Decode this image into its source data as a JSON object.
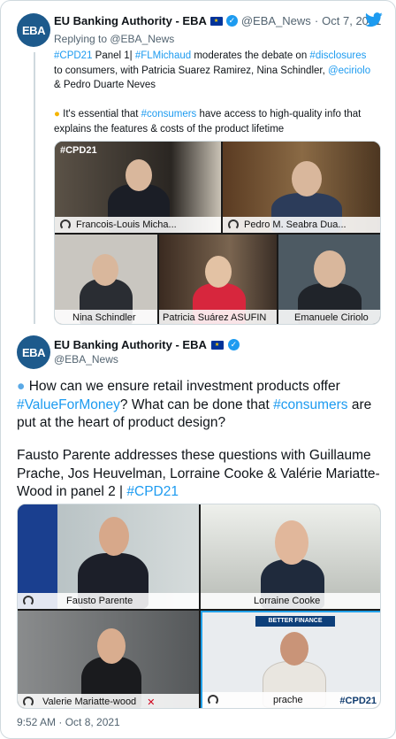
{
  "tweet1": {
    "avatar_text": "EBA",
    "name": "EU Banking Authority - EBA",
    "handle": "@EBA_News",
    "separator": "·",
    "date": "Oct 7, 2021",
    "replying_to": "Replying to @EBA_News",
    "line1_parts": [
      "#CPD21",
      " Panel 1| ",
      "#FLMichaud",
      " moderates the debate on ",
      "#disclosures"
    ],
    "line2_parts": [
      "to consumers, with Patricia Suarez Ramirez, Nina Schindler, ",
      "@eciriolo"
    ],
    "line3": "& Pedro Duarte Neves",
    "line5_parts": [
      "It's essential that ",
      "#consumers",
      " have access to high-quality info that"
    ],
    "line6": "explains the features & costs of the product lifetime",
    "video_badge": "#CPD21",
    "participants": [
      "Francois-Louis Micha...",
      "Pedro M. Seabra Dua...",
      "Nina Schindler",
      "Patricia Suárez ASUFIN",
      "Emanuele Ciriolo"
    ]
  },
  "tweet2": {
    "avatar_text": "EBA",
    "name": "EU Banking Authority - EBA",
    "handle": "@EBA_News",
    "p1_parts": [
      "How can we ensure retail investment products offer ",
      "#ValueForMoney",
      "? What can be done that ",
      "#consumers",
      " are put at the heart of product design?"
    ],
    "p2_parts": [
      "Fausto Parente addresses these questions with Guillaume Prache, Jos Heuvelman, Lorraine Cooke & Valérie Mariatte-Wood in panel 2 | ",
      "#CPD21"
    ],
    "participants": [
      "Fausto Parente",
      "Lorraine Cooke",
      "Valerie Mariatte-wood",
      "prache"
    ],
    "video_badge": "#CPD21",
    "banner_text": "BETTER FINANCE",
    "timestamp": "9:52 AM · Oct 8, 2021"
  },
  "colors": {
    "link": "#1d9bf0",
    "muted": "#536471",
    "avatar": "#1d5a8c",
    "highlight": "#21a0e8"
  }
}
